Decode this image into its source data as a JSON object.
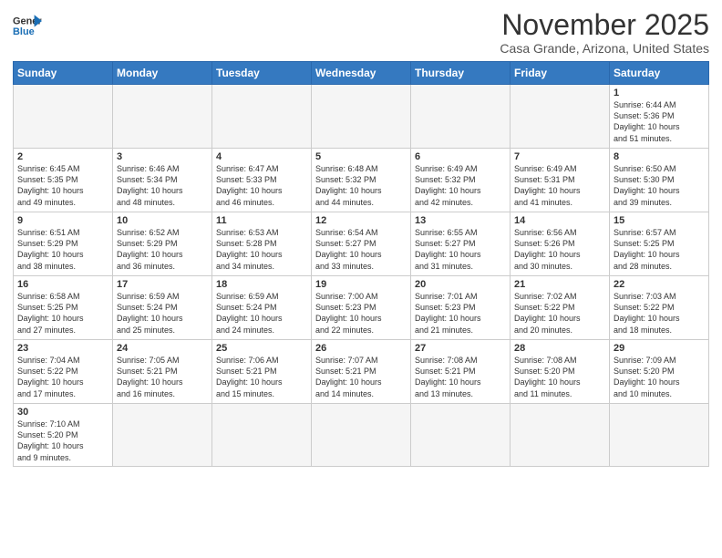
{
  "header": {
    "logo_general": "General",
    "logo_blue": "Blue",
    "month_title": "November 2025",
    "location": "Casa Grande, Arizona, United States"
  },
  "days_of_week": [
    "Sunday",
    "Monday",
    "Tuesday",
    "Wednesday",
    "Thursday",
    "Friday",
    "Saturday"
  ],
  "weeks": [
    [
      {
        "num": "",
        "info": ""
      },
      {
        "num": "",
        "info": ""
      },
      {
        "num": "",
        "info": ""
      },
      {
        "num": "",
        "info": ""
      },
      {
        "num": "",
        "info": ""
      },
      {
        "num": "",
        "info": ""
      },
      {
        "num": "1",
        "info": "Sunrise: 6:44 AM\nSunset: 5:36 PM\nDaylight: 10 hours\nand 51 minutes."
      }
    ],
    [
      {
        "num": "2",
        "info": "Sunrise: 6:45 AM\nSunset: 5:35 PM\nDaylight: 10 hours\nand 49 minutes."
      },
      {
        "num": "3",
        "info": "Sunrise: 6:46 AM\nSunset: 5:34 PM\nDaylight: 10 hours\nand 48 minutes."
      },
      {
        "num": "4",
        "info": "Sunrise: 6:47 AM\nSunset: 5:33 PM\nDaylight: 10 hours\nand 46 minutes."
      },
      {
        "num": "5",
        "info": "Sunrise: 6:48 AM\nSunset: 5:32 PM\nDaylight: 10 hours\nand 44 minutes."
      },
      {
        "num": "6",
        "info": "Sunrise: 6:49 AM\nSunset: 5:32 PM\nDaylight: 10 hours\nand 42 minutes."
      },
      {
        "num": "7",
        "info": "Sunrise: 6:49 AM\nSunset: 5:31 PM\nDaylight: 10 hours\nand 41 minutes."
      },
      {
        "num": "8",
        "info": "Sunrise: 6:50 AM\nSunset: 5:30 PM\nDaylight: 10 hours\nand 39 minutes."
      }
    ],
    [
      {
        "num": "9",
        "info": "Sunrise: 6:51 AM\nSunset: 5:29 PM\nDaylight: 10 hours\nand 38 minutes."
      },
      {
        "num": "10",
        "info": "Sunrise: 6:52 AM\nSunset: 5:29 PM\nDaylight: 10 hours\nand 36 minutes."
      },
      {
        "num": "11",
        "info": "Sunrise: 6:53 AM\nSunset: 5:28 PM\nDaylight: 10 hours\nand 34 minutes."
      },
      {
        "num": "12",
        "info": "Sunrise: 6:54 AM\nSunset: 5:27 PM\nDaylight: 10 hours\nand 33 minutes."
      },
      {
        "num": "13",
        "info": "Sunrise: 6:55 AM\nSunset: 5:27 PM\nDaylight: 10 hours\nand 31 minutes."
      },
      {
        "num": "14",
        "info": "Sunrise: 6:56 AM\nSunset: 5:26 PM\nDaylight: 10 hours\nand 30 minutes."
      },
      {
        "num": "15",
        "info": "Sunrise: 6:57 AM\nSunset: 5:25 PM\nDaylight: 10 hours\nand 28 minutes."
      }
    ],
    [
      {
        "num": "16",
        "info": "Sunrise: 6:58 AM\nSunset: 5:25 PM\nDaylight: 10 hours\nand 27 minutes."
      },
      {
        "num": "17",
        "info": "Sunrise: 6:59 AM\nSunset: 5:24 PM\nDaylight: 10 hours\nand 25 minutes."
      },
      {
        "num": "18",
        "info": "Sunrise: 6:59 AM\nSunset: 5:24 PM\nDaylight: 10 hours\nand 24 minutes."
      },
      {
        "num": "19",
        "info": "Sunrise: 7:00 AM\nSunset: 5:23 PM\nDaylight: 10 hours\nand 22 minutes."
      },
      {
        "num": "20",
        "info": "Sunrise: 7:01 AM\nSunset: 5:23 PM\nDaylight: 10 hours\nand 21 minutes."
      },
      {
        "num": "21",
        "info": "Sunrise: 7:02 AM\nSunset: 5:22 PM\nDaylight: 10 hours\nand 20 minutes."
      },
      {
        "num": "22",
        "info": "Sunrise: 7:03 AM\nSunset: 5:22 PM\nDaylight: 10 hours\nand 18 minutes."
      }
    ],
    [
      {
        "num": "23",
        "info": "Sunrise: 7:04 AM\nSunset: 5:22 PM\nDaylight: 10 hours\nand 17 minutes."
      },
      {
        "num": "24",
        "info": "Sunrise: 7:05 AM\nSunset: 5:21 PM\nDaylight: 10 hours\nand 16 minutes."
      },
      {
        "num": "25",
        "info": "Sunrise: 7:06 AM\nSunset: 5:21 PM\nDaylight: 10 hours\nand 15 minutes."
      },
      {
        "num": "26",
        "info": "Sunrise: 7:07 AM\nSunset: 5:21 PM\nDaylight: 10 hours\nand 14 minutes."
      },
      {
        "num": "27",
        "info": "Sunrise: 7:08 AM\nSunset: 5:21 PM\nDaylight: 10 hours\nand 13 minutes."
      },
      {
        "num": "28",
        "info": "Sunrise: 7:08 AM\nSunset: 5:20 PM\nDaylight: 10 hours\nand 11 minutes."
      },
      {
        "num": "29",
        "info": "Sunrise: 7:09 AM\nSunset: 5:20 PM\nDaylight: 10 hours\nand 10 minutes."
      }
    ],
    [
      {
        "num": "30",
        "info": "Sunrise: 7:10 AM\nSunset: 5:20 PM\nDaylight: 10 hours\nand 9 minutes."
      },
      {
        "num": "",
        "info": ""
      },
      {
        "num": "",
        "info": ""
      },
      {
        "num": "",
        "info": ""
      },
      {
        "num": "",
        "info": ""
      },
      {
        "num": "",
        "info": ""
      },
      {
        "num": "",
        "info": ""
      }
    ]
  ]
}
